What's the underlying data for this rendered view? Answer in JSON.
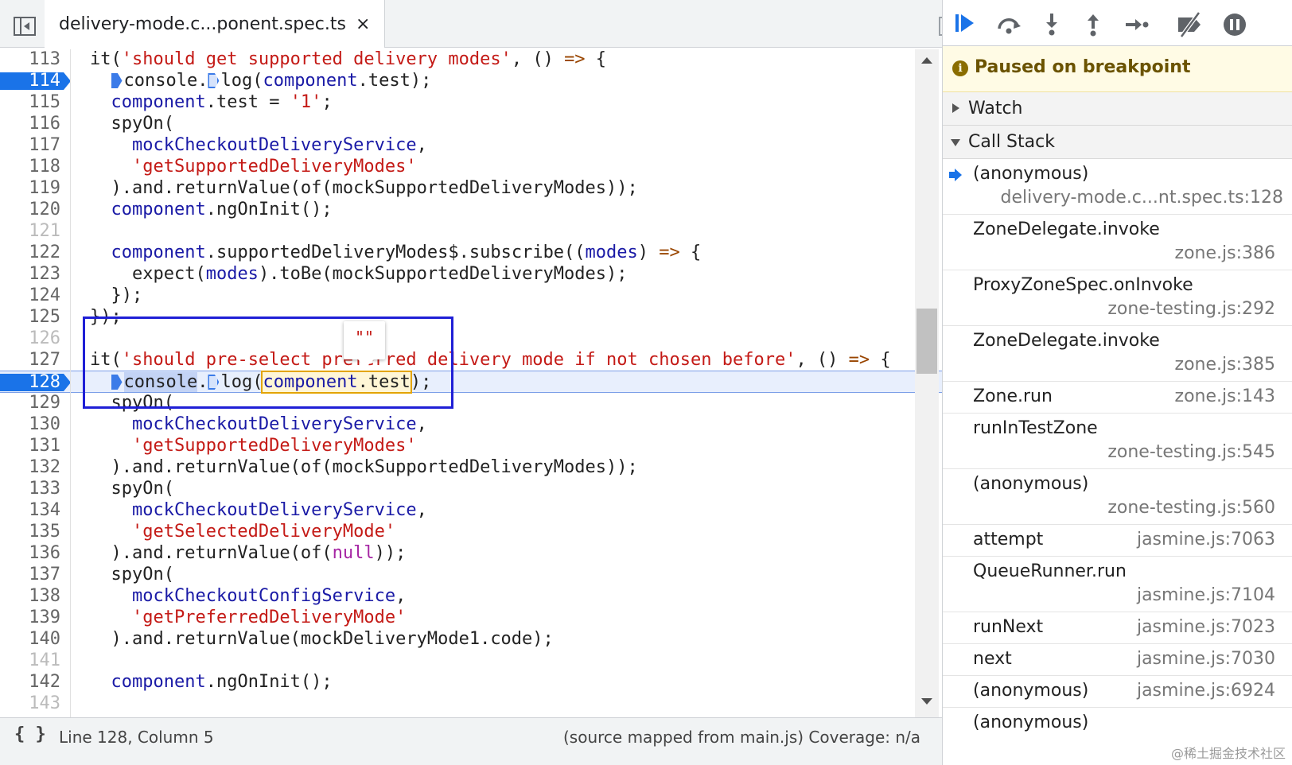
{
  "editor": {
    "tab_label": "delivery-mode.c...ponent.spec.ts",
    "tab_close": "×",
    "lines": [
      {
        "n": "113",
        "t": "  it('should get supported delivery modes', () => {"
      },
      {
        "n": "114",
        "t": "    console.log(component.test);",
        "bp": true
      },
      {
        "n": "115",
        "t": "    component.test = '1';"
      },
      {
        "n": "116",
        "t": "    spyOn("
      },
      {
        "n": "117",
        "t": "      mockCheckoutDeliveryService,"
      },
      {
        "n": "118",
        "t": "      'getSupportedDeliveryModes'"
      },
      {
        "n": "119",
        "t": "    ).and.returnValue(of(mockSupportedDeliveryModes));"
      },
      {
        "n": "120",
        "t": "    component.ngOnInit();"
      },
      {
        "n": "121",
        "t": "",
        "blank": true
      },
      {
        "n": "122",
        "t": "    component.supportedDeliveryModes$.subscribe((modes) => {"
      },
      {
        "n": "123",
        "t": "      expect(modes).toBe(mockSupportedDeliveryModes);"
      },
      {
        "n": "124",
        "t": "    });"
      },
      {
        "n": "125",
        "t": "  });"
      },
      {
        "n": "126",
        "t": "",
        "blank": true
      },
      {
        "n": "127",
        "t": "  it('should pre-select preferred delivery mode if not chosen before', () => {"
      },
      {
        "n": "128",
        "t": "    console.log(component.test);",
        "bp": true,
        "exec": true
      },
      {
        "n": "129",
        "t": "    spyOn("
      },
      {
        "n": "130",
        "t": "      mockCheckoutDeliveryService,"
      },
      {
        "n": "131",
        "t": "      'getSupportedDeliveryModes'"
      },
      {
        "n": "132",
        "t": "    ).and.returnValue(of(mockSupportedDeliveryModes));"
      },
      {
        "n": "133",
        "t": "    spyOn("
      },
      {
        "n": "134",
        "t": "      mockCheckoutDeliveryService,"
      },
      {
        "n": "135",
        "t": "      'getSelectedDeliveryMode'"
      },
      {
        "n": "136",
        "t": "    ).and.returnValue(of(null));"
      },
      {
        "n": "137",
        "t": "    spyOn("
      },
      {
        "n": "138",
        "t": "      mockCheckoutConfigService,"
      },
      {
        "n": "139",
        "t": "      'getPreferredDeliveryMode'"
      },
      {
        "n": "140",
        "t": "    ).and.returnValue(mockDeliveryMode1.code);"
      },
      {
        "n": "141",
        "t": "",
        "blank": true
      },
      {
        "n": "142",
        "t": "    component.ngOnInit();"
      },
      {
        "n": "143",
        "t": "",
        "blank": true
      }
    ],
    "popover_value": "\"\"",
    "status": {
      "format_icon": "{ }",
      "cursor": "Line 128, Column 5",
      "source_map": "(source mapped from main.js)  Coverage: n/a"
    }
  },
  "sidebar": {
    "paused_text": "Paused on breakpoint",
    "info_icon": "i",
    "watch_label": "Watch",
    "call_stack_label": "Call Stack",
    "frames": [
      {
        "name": "(anonymous)",
        "loc": "delivery-mode.c...nt.spec.ts:128",
        "current": true,
        "two_line": true
      },
      {
        "name": "ZoneDelegate.invoke",
        "loc": "zone.js:386",
        "two_line": true
      },
      {
        "name": "ProxyZoneSpec.onInvoke",
        "loc": "zone-testing.js:292",
        "two_line": true
      },
      {
        "name": "ZoneDelegate.invoke",
        "loc": "zone.js:385",
        "two_line": true
      },
      {
        "name": "Zone.run",
        "loc": "zone.js:143",
        "two_line": false
      },
      {
        "name": "runInTestZone",
        "loc": "zone-testing.js:545",
        "two_line": true
      },
      {
        "name": "(anonymous)",
        "loc": "zone-testing.js:560",
        "two_line": true
      },
      {
        "name": "attempt",
        "loc": "jasmine.js:7063",
        "two_line": false
      },
      {
        "name": "QueueRunner.run",
        "loc": "jasmine.js:7104",
        "two_line": true
      },
      {
        "name": "runNext",
        "loc": "jasmine.js:7023",
        "two_line": false
      },
      {
        "name": "next",
        "loc": "jasmine.js:7030",
        "two_line": false
      },
      {
        "name": "(anonymous)",
        "loc": "jasmine.js:6924",
        "two_line": false
      },
      {
        "name": "(anonymous)",
        "loc": "",
        "two_line": false
      }
    ],
    "watermark": "@稀土掘金技术社区"
  },
  "colors": {
    "accent": "#1a73e8",
    "string": "#c41a16",
    "variable": "#1a1aa6",
    "keyword": "#a626a4",
    "annotation_box": "#1f1fd6",
    "paused_banner": "#fffbe5"
  }
}
